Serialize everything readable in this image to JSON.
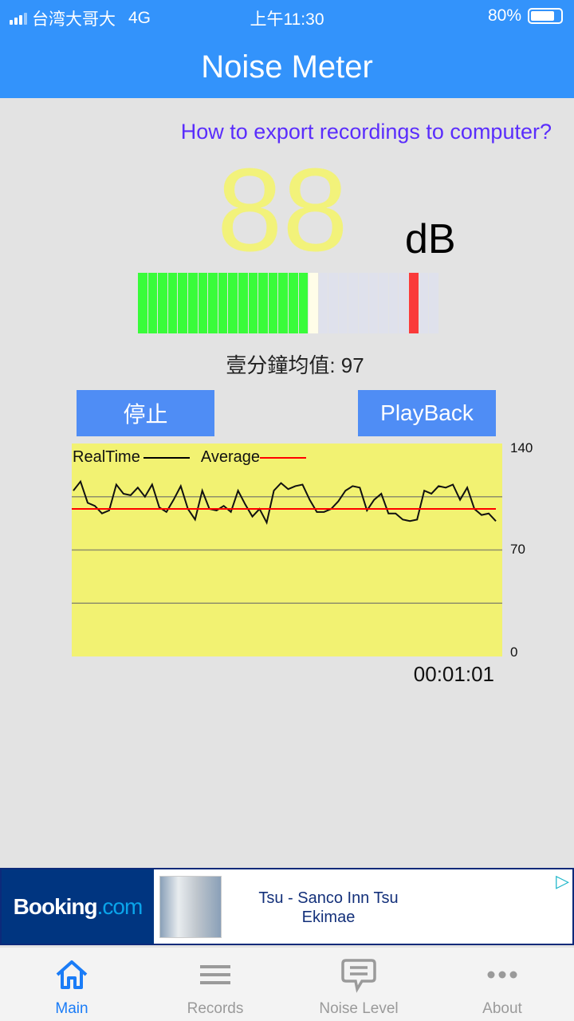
{
  "status_bar": {
    "carrier": "台湾大哥大",
    "network": "4G",
    "time": "上午11:30",
    "battery": "80%",
    "battery_level": 0.8
  },
  "header": {
    "title": "Noise Meter"
  },
  "main": {
    "export_link": "How to export recordings to computer?",
    "current_db": "88",
    "unit": "dB",
    "meter": {
      "segments": 30,
      "lit_segments": 17,
      "peak_hold_segment": 17,
      "max_marker_segment": 27,
      "colors": {
        "lit": "#39fc3a",
        "peak": "#fffde8",
        "max": "#fa3a3a",
        "off": "#dfe1ec"
      }
    },
    "average_label": "壹分鐘均值: 97",
    "stop_button": "停止",
    "playback_button": "PlayBack",
    "timer": "00:01:01"
  },
  "chart_data": {
    "type": "line",
    "ylim": [
      0,
      140
    ],
    "yticks": [
      "140",
      "70",
      "0"
    ],
    "grid": true,
    "gridlines": [
      35,
      70,
      105
    ],
    "background": "#f2f272",
    "legend": [
      {
        "name": "RealTime",
        "color": "#000000"
      },
      {
        "name": "Average",
        "color": "#ff0000"
      }
    ],
    "series": [
      {
        "name": "RealTime",
        "values": [
          109,
          115,
          101,
          99,
          94,
          96,
          113,
          107,
          106,
          111,
          105,
          113,
          98,
          95,
          103,
          112,
          97,
          90,
          109,
          97,
          96,
          99,
          95,
          109,
          100,
          92,
          97,
          88,
          109,
          114,
          110,
          112,
          113,
          103,
          95,
          95,
          97,
          102,
          109,
          112,
          111,
          96,
          103,
          107,
          94,
          94,
          90,
          89,
          90,
          109,
          107,
          112,
          111,
          113,
          103,
          111,
          97,
          93,
          94,
          89
        ]
      },
      {
        "name": "Average",
        "values": [
          97
        ]
      }
    ]
  },
  "ad": {
    "brand": "Booking",
    "brand_suffix": ".com",
    "text_line1": "Tsu - Sanco Inn Tsu",
    "text_line2": "Ekimae"
  },
  "tabs": [
    {
      "label": "Main",
      "icon": "home-icon",
      "active": true
    },
    {
      "label": "Records",
      "icon": "list-icon"
    },
    {
      "label": "Noise Level",
      "icon": "chat-bubble-icon"
    },
    {
      "label": "About",
      "icon": "more-icon"
    }
  ]
}
